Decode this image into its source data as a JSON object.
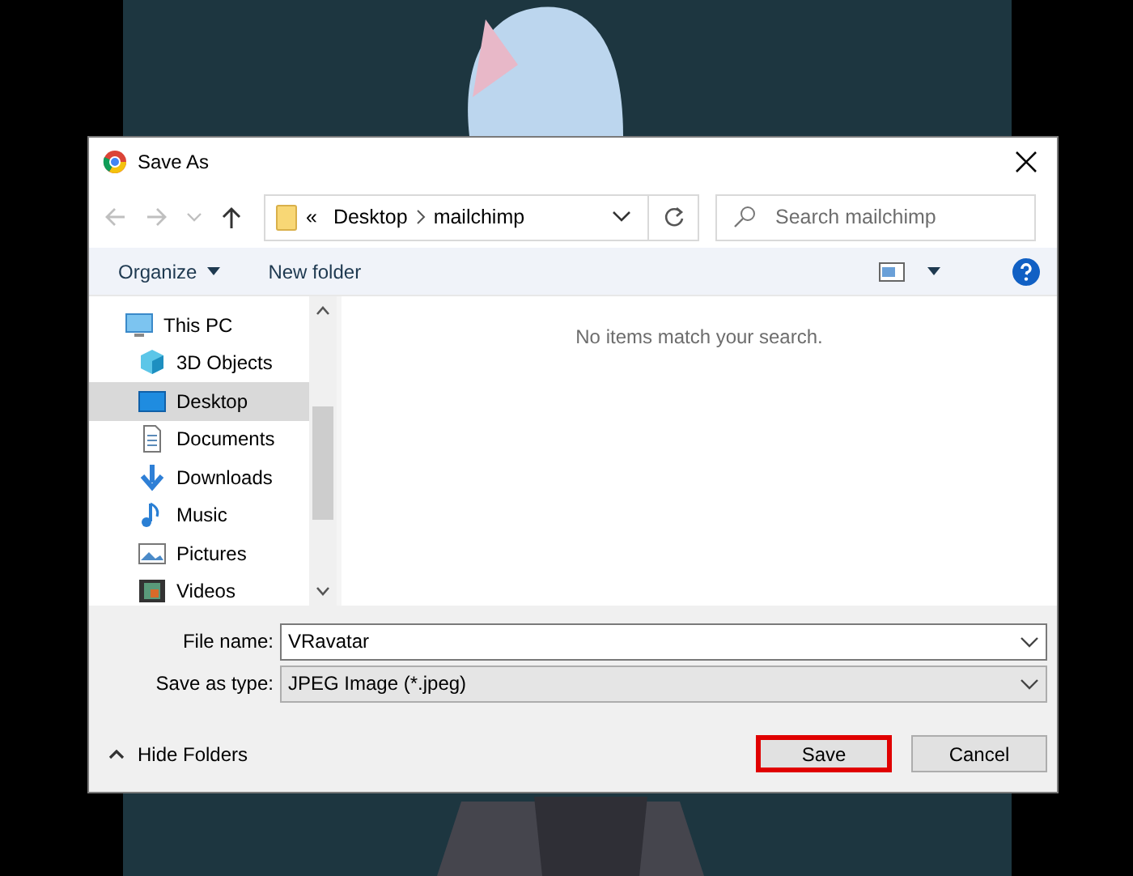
{
  "window": {
    "title": "Save As"
  },
  "address": {
    "overflow": "«",
    "path": [
      {
        "label": "Desktop"
      },
      {
        "label": "mailchimp"
      }
    ]
  },
  "search": {
    "placeholder": "Search mailchimp"
  },
  "toolbar": {
    "organize": "Organize",
    "new_folder": "New folder"
  },
  "sidebar": {
    "items": [
      {
        "label": "This PC",
        "kind": "pc",
        "selected": false,
        "children": [
          {
            "label": "3D Objects",
            "kind": "cube",
            "selected": false
          },
          {
            "label": "Desktop",
            "kind": "desktop",
            "selected": true
          },
          {
            "label": "Documents",
            "kind": "document",
            "selected": false
          },
          {
            "label": "Downloads",
            "kind": "download",
            "selected": false
          },
          {
            "label": "Music",
            "kind": "music",
            "selected": false
          },
          {
            "label": "Pictures",
            "kind": "pictures",
            "selected": false
          },
          {
            "label": "Videos",
            "kind": "videos",
            "selected": false
          }
        ]
      }
    ]
  },
  "content": {
    "message": "No items match your search."
  },
  "file_name": {
    "label": "File name:",
    "value": "VRavatar"
  },
  "save_as_type": {
    "label": "Save as type:",
    "value": "JPEG Image (*.jpeg)"
  },
  "hide_folders": "Hide Folders",
  "buttons": [
    {
      "label": "Save",
      "highlighted": true
    },
    {
      "label": "Cancel",
      "highlighted": false
    }
  ]
}
